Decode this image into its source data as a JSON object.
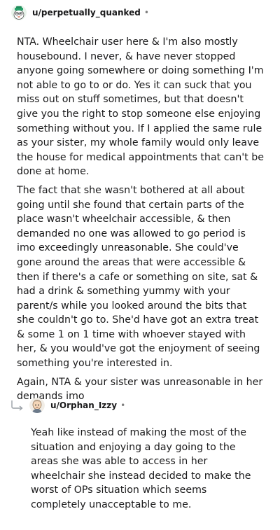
{
  "comment": {
    "username": "u/perpetually_quanked",
    "separator": "•",
    "paragraphs": [
      "NTA. Wheelchair user here & I'm also mostly housebound. I never, & have never stopped anyone going somewhere or doing something I'm not able to go to or do. Yes it can suck that you miss out on stuff sometimes, but that doesn't give you the right to stop someone else enjoying something without you. If I applied the same rule as your sister, my whole family would only leave the house for medical appointments that can't be done at home.",
      "The fact that she wasn't bothered at all about going until she found that certain parts of the place wasn't wheelchair accessible, & then demanded no one was allowed to go period is imo exceedingly unreasonable. She could've gone around the areas that were accessible & then if there's a cafe or something on site, sat & had a drink & something yummy with your parent/s while you looked around the bits that she couldn't go to. She'd have got an extra treat & some 1 on 1 time with whoever stayed with her, & you would've got the enjoyment of seeing something you're interested in.",
      "Again, NTA & your sister was unreasonable in her demands imo"
    ]
  },
  "reply": {
    "username": "u/Orphan_Izzy",
    "separator": "•",
    "paragraphs": [
      "Yeah like instead of making the most of the situation and enjoying a day going to the areas she was able to access in her wheelchair she instead decided to make the worst of OPs situation which seems completely unacceptable to me."
    ]
  }
}
